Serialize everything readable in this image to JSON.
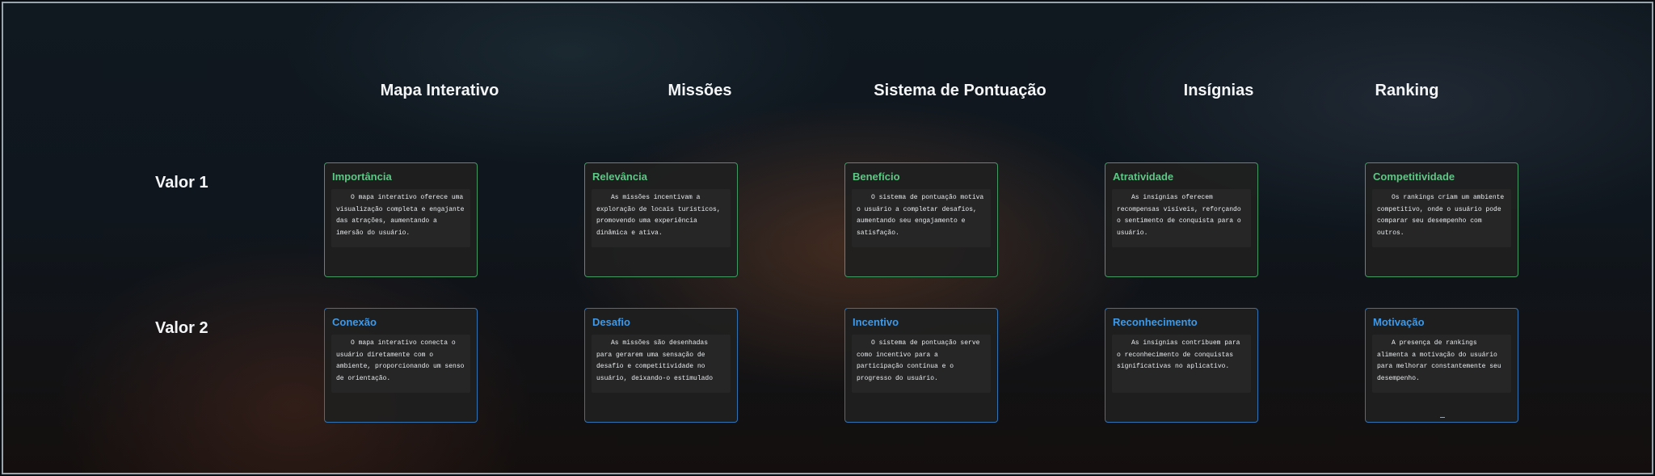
{
  "columns": [
    {
      "label": "Mapa Interativo"
    },
    {
      "label": "Missões"
    },
    {
      "label": "Sistema de Pontuação"
    },
    {
      "label": "Insígnias"
    },
    {
      "label": "Ranking"
    }
  ],
  "rows": [
    {
      "label": "Valor 1"
    },
    {
      "label": "Valor 2"
    }
  ],
  "cards": {
    "valor1": [
      {
        "title": "Importância",
        "text": "O mapa interativo oferece uma visualização completa e engajante das atrações, aumentando a imersão do usuário."
      },
      {
        "title": "Relevância",
        "text": "As missões incentivam a exploração de locais turísticos, promovendo uma experiência dinâmica e ativa."
      },
      {
        "title": "Benefício",
        "text": "O sistema de pontuação motiva o usuário a completar desafios, aumentando seu engajamento e satisfação."
      },
      {
        "title": "Atratividade",
        "text": "As insígnias oferecem recompensas visíveis, reforçando o sentimento de conquista para o usuário."
      },
      {
        "title": "Competitividade",
        "text": "Os rankings criam um ambiente competitivo, onde o usuário pode comparar seu desempenho com outros."
      }
    ],
    "valor2": [
      {
        "title": "Conexão",
        "text": "O mapa interativo conecta o usuário diretamente com o ambiente, proporcionando um senso de orientação."
      },
      {
        "title": "Desafio",
        "text": "As missões são desenhadas para gerarem uma sensação de desafio e competitividade no usuário, deixando-o estimulado"
      },
      {
        "title": "Incentivo",
        "text": "O sistema de pontuação serve como incentivo para a participação contínua e o progresso do usuário."
      },
      {
        "title": "Reconhecimento",
        "text": "As insígnias contribuem para o reconhecimento de conquistas significativas no aplicativo."
      },
      {
        "title": "Motivação",
        "text": "A presença de rankings alimenta a motivação do usuário para melhorar constantemente seu desempenho."
      }
    ]
  },
  "colors": {
    "valor1_accent": "#5dc785",
    "valor2_accent": "#3f99e6",
    "card_background": "#202020"
  }
}
